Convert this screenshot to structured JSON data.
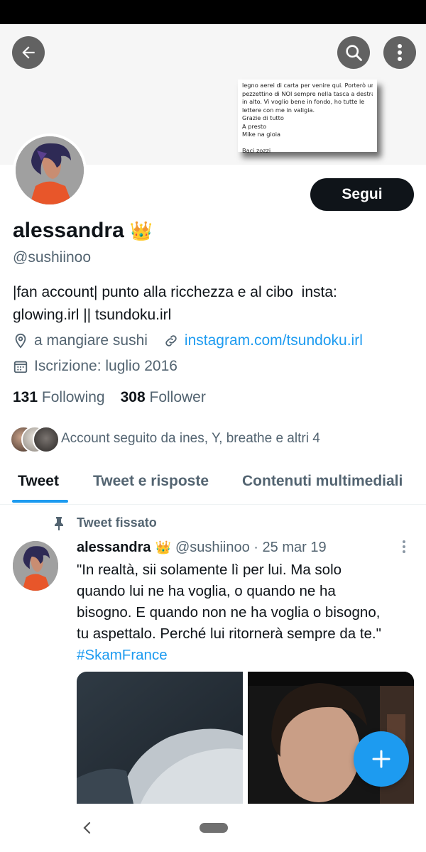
{
  "header": {
    "note_lines": [
      "legno aerei di carta per venire qui. Porterò un",
      "pezzettino di NOI sempre nella tasca a destra",
      "in alto. Vi voglio bene in fondo, ho tutte le",
      "lettere con me in valigia.",
      "Grazie di tutto",
      "A presto",
      "Mike na gioia",
      "",
      "Baci zozzi"
    ]
  },
  "profile": {
    "follow_label": "Segui",
    "name": "alessandra",
    "name_emoji": "👑",
    "handle": "@sushiinoo",
    "bio_line1": "|fan account| punto alla ricchezza e al cibo  insta:",
    "bio_line2": "glowing.irl || tsundoku.irl",
    "location": "a mangiare sushi",
    "website": "instagram.com/tsundoku.irl",
    "joined": "Iscrizione: luglio 2016",
    "following_count": "131",
    "following_label": "Following",
    "followers_count": "308",
    "followers_label": "Follower",
    "followed_by": "Account seguito da ines, Y, breathe e altri 4"
  },
  "tabs": [
    {
      "label": "Tweet",
      "active": true
    },
    {
      "label": "Tweet e risposte",
      "active": false
    },
    {
      "label": "Contenuti multimediali",
      "active": false
    }
  ],
  "pinned_tweet": {
    "pinned_label": "Tweet fissato",
    "author": "alessandra",
    "author_emoji": "👑",
    "handle_date": "@sushiinoo · 25 mar 19",
    "text_lines": [
      "\"In realtà, sii solamente lì per lui. Ma solo",
      "quando lui ne ha voglia, o quando ne ha",
      "bisogno. E quando non ne ha voglia o bisogno,",
      "tu aspettalo. Perché lui ritornerà sempre da te.\""
    ],
    "hashtag": "#SkamFrance"
  },
  "colors": {
    "accent": "#1d9bf0",
    "text_primary": "#0f1419",
    "text_secondary": "#536471"
  },
  "icons": [
    "back-arrow-icon",
    "search-icon",
    "more-vertical-icon",
    "location-pin-icon",
    "link-icon",
    "calendar-icon",
    "pin-icon",
    "more-vertical-icon",
    "plus-icon",
    "back-nav-icon"
  ]
}
